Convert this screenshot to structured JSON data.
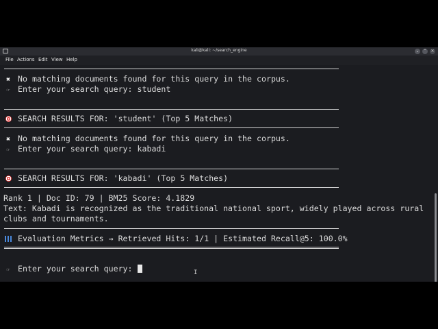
{
  "window": {
    "title": "kali@kali: ~/search_engine",
    "minimize_glyph": "⌄",
    "maximize_glyph": "⌃",
    "close_glyph": "✕"
  },
  "menu": {
    "items": [
      "File",
      "Actions",
      "Edit",
      "View",
      "Help"
    ]
  },
  "terminal": {
    "lines": {
      "no_match_1": "No matching documents found for this query in the corpus.",
      "prompt_1": "Enter your search query: student",
      "results_header_1": "SEARCH RESULTS FOR: 'student' (Top 5 Matches)",
      "no_match_2": "No matching documents found for this query in the corpus.",
      "prompt_2": "Enter your search query: kabadi",
      "results_header_2": "SEARCH RESULTS FOR: 'kabadi' (Top 5 Matches)",
      "rank_line": "Rank 1 | Doc ID: 79 | BM25 Score: 4.1829",
      "text_line_1": "Text: Kabadi is recognized as the traditional national sport, widely played across rural",
      "text_line_2": "clubs and tournaments.",
      "metrics_line": "Evaluation Metrics → Retrieved Hits: 1/1 | Estimated Recall@5: 100.0%",
      "prompt_current": "Enter your search query: "
    },
    "glyphs": {
      "cross": "✖",
      "hand": "☞"
    }
  },
  "colors": {
    "background": "#1b1c20",
    "text": "#dcdcdc",
    "accent_red": "#e23a3a",
    "accent_blue": "#4a89dc"
  }
}
